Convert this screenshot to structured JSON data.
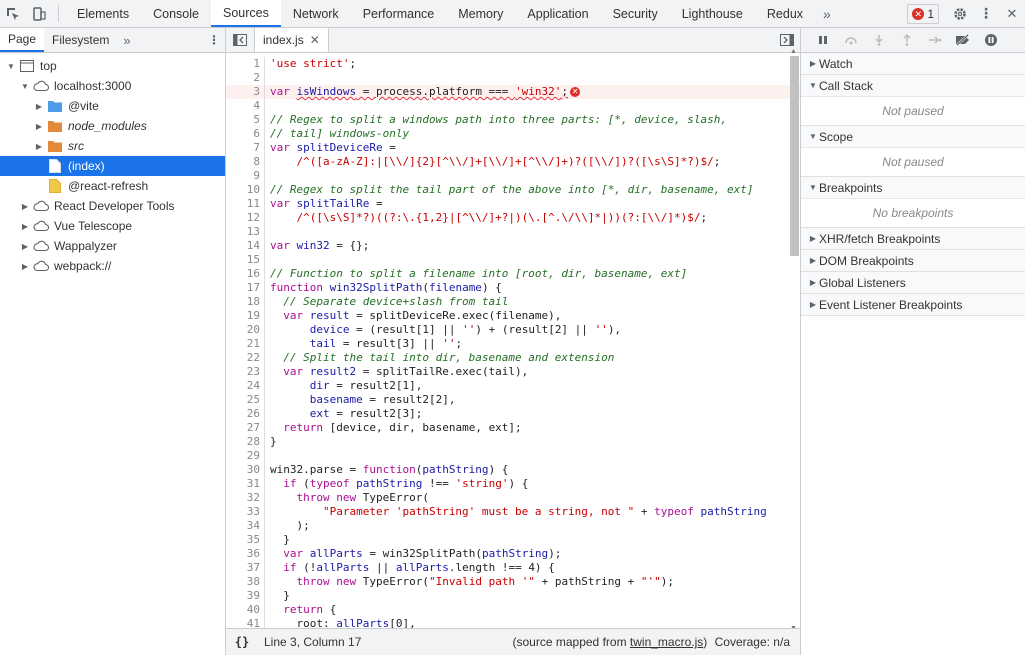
{
  "topbar": {
    "tabs": [
      {
        "label": "Elements"
      },
      {
        "label": "Console"
      },
      {
        "label": "Sources"
      },
      {
        "label": "Network"
      },
      {
        "label": "Performance"
      },
      {
        "label": "Memory"
      },
      {
        "label": "Application"
      },
      {
        "label": "Security"
      },
      {
        "label": "Lighthouse"
      },
      {
        "label": "Redux"
      }
    ],
    "active_tab": "Sources",
    "more_label": "»",
    "error_count": "1"
  },
  "navigator": {
    "tabs": [
      {
        "label": "Page"
      },
      {
        "label": "Filesystem"
      }
    ],
    "more_label": "»",
    "tree": [
      {
        "label": "top",
        "depth": 0,
        "tri": "▼",
        "icon": "frame-icon"
      },
      {
        "label": "localhost:3000",
        "depth": 1,
        "tri": "▼",
        "icon": "cloud-icon"
      },
      {
        "label": "@vite",
        "depth": 2,
        "tri": "▶",
        "icon": "folder-blue-icon"
      },
      {
        "label": "node_modules",
        "depth": 2,
        "tri": "▶",
        "icon": "folder-orange-icon",
        "italic": true
      },
      {
        "label": "src",
        "depth": 2,
        "tri": "▶",
        "icon": "folder-orange-icon",
        "italic": true
      },
      {
        "label": "(index)",
        "depth": 2,
        "tri": "",
        "icon": "file-white-icon",
        "selected": true
      },
      {
        "label": "@react-refresh",
        "depth": 2,
        "tri": "",
        "icon": "file-yellow-icon"
      },
      {
        "label": "React Developer Tools",
        "depth": 1,
        "tri": "▶",
        "icon": "cloud-icon"
      },
      {
        "label": "Vue Telescope",
        "depth": 1,
        "tri": "▶",
        "icon": "cloud-icon"
      },
      {
        "label": "Wappalyzer",
        "depth": 1,
        "tri": "▶",
        "icon": "cloud-icon"
      },
      {
        "label": "webpack://",
        "depth": 1,
        "tri": "▶",
        "icon": "cloud-icon"
      }
    ]
  },
  "editor": {
    "tab_label": "index.js",
    "tab_close": "✕",
    "lines": [
      {
        "n": "1",
        "html": "<span class='st'>'use strict'</span>;"
      },
      {
        "n": "2",
        "html": ""
      },
      {
        "n": "3",
        "err": true,
        "html": "<span class='kw'>var</span> <span class='var wavy'>isWindows</span><span class='wavy'> = process.platform === </span><span class='st wavy'>'win32'</span><span class='wavy'>;</span><span class='err-circle'>✕</span>"
      },
      {
        "n": "4",
        "html": ""
      },
      {
        "n": "5",
        "html": "<span class='cm'>// Regex to split a windows path into three parts: [*, device, slash,</span>"
      },
      {
        "n": "6",
        "html": "<span class='cm'>// tail] windows-only</span>"
      },
      {
        "n": "7",
        "html": "<span class='kw'>var</span> <span class='var'>splitDeviceRe</span> ="
      },
      {
        "n": "8",
        "html": "    <span class='st'>/^([a-zA-Z]:|[\\\\/]{2}[^\\\\/]+[\\\\/]+[^\\\\/]+)?([\\\\/])?([\\s\\S]*?)$/</span>;"
      },
      {
        "n": "9",
        "html": ""
      },
      {
        "n": "10",
        "html": "<span class='cm'>// Regex to split the tail part of the above into [*, dir, basename, ext]</span>"
      },
      {
        "n": "11",
        "html": "<span class='kw'>var</span> <span class='var'>splitTailRe</span> ="
      },
      {
        "n": "12",
        "html": "    <span class='st'>/^([\\s\\S]*?)((?:\\.{1,2}|[^\\\\/]+?|)(\\.[^.\\/\\\\]*|))(?:[\\\\/]*)$/</span>;"
      },
      {
        "n": "13",
        "html": ""
      },
      {
        "n": "14",
        "html": "<span class='kw'>var</span> <span class='var'>win32</span> = {};"
      },
      {
        "n": "15",
        "html": ""
      },
      {
        "n": "16",
        "html": "<span class='cm'>// Function to split a filename into [root, dir, basename, ext]</span>"
      },
      {
        "n": "17",
        "html": "<span class='kw'>function</span> <span class='fn'>win32SplitPath</span>(<span class='var'>filename</span>) {"
      },
      {
        "n": "18",
        "html": "  <span class='cm'>// Separate device+slash from tail</span>"
      },
      {
        "n": "19",
        "html": "  <span class='kw'>var</span> <span class='var'>result</span> = splitDeviceRe.exec(filename),"
      },
      {
        "n": "20",
        "html": "      <span class='var'>device</span> = (result[1] || <span class='st'>''</span>) + (result[2] || <span class='st'>''</span>),"
      },
      {
        "n": "21",
        "html": "      <span class='var'>tail</span> = result[3] || <span class='st'>''</span>;"
      },
      {
        "n": "22",
        "html": "  <span class='cm'>// Split the tail into dir, basename and extension</span>"
      },
      {
        "n": "23",
        "html": "  <span class='kw'>var</span> <span class='var'>result2</span> = splitTailRe.exec(tail),"
      },
      {
        "n": "24",
        "html": "      <span class='var'>dir</span> = result2[1],"
      },
      {
        "n": "25",
        "html": "      <span class='var'>basename</span> = result2[2],"
      },
      {
        "n": "26",
        "html": "      <span class='var'>ext</span> = result2[3];"
      },
      {
        "n": "27",
        "html": "  <span class='kw'>return</span> [device, dir, basename, ext];"
      },
      {
        "n": "28",
        "html": "}"
      },
      {
        "n": "29",
        "html": ""
      },
      {
        "n": "30",
        "html": "win32.parse = <span class='kw'>function</span>(<span class='var'>pathString</span>) {"
      },
      {
        "n": "31",
        "html": "  <span class='kw'>if</span> (<span class='kw'>typeof</span> <span class='var'>pathString</span> !== <span class='st'>'string'</span>) {"
      },
      {
        "n": "32",
        "html": "    <span class='kw'>throw</span> <span class='kw'>new</span> TypeError("
      },
      {
        "n": "33",
        "html": "        <span class='st'>\"Parameter 'pathString' must be a string, not \"</span> + <span class='kw'>typeof</span> <span class='var'>pathString</span>"
      },
      {
        "n": "34",
        "html": "    );"
      },
      {
        "n": "35",
        "html": "  }"
      },
      {
        "n": "36",
        "html": "  <span class='kw'>var</span> <span class='var'>allParts</span> = win32SplitPath(<span class='var'>pathString</span>);"
      },
      {
        "n": "37",
        "html": "  <span class='kw'>if</span> (!<span class='var'>allParts</span> || <span class='var'>allParts</span>.length !== 4) {"
      },
      {
        "n": "38",
        "html": "    <span class='kw'>throw</span> <span class='kw'>new</span> TypeError(<span class='st'>\"Invalid path '\"</span> + pathString + <span class='st'>\"'\"</span>);"
      },
      {
        "n": "39",
        "html": "  }"
      },
      {
        "n": "40",
        "html": "  <span class='kw'>return</span> {"
      },
      {
        "n": "41",
        "html": "    root: <span class='var'>allParts</span>[0],"
      }
    ],
    "status": {
      "braces": "{}",
      "position": "Line 3, Column 17",
      "source_prefix": "(source mapped from ",
      "source_link": "twin_macro.js",
      "source_suffix": ")",
      "coverage": "Coverage: n/a"
    }
  },
  "debugger": {
    "sections": [
      {
        "label": "Watch",
        "open": false
      },
      {
        "label": "Call Stack",
        "open": true,
        "body": "Not paused"
      },
      {
        "label": "Scope",
        "open": true,
        "body": "Not paused"
      },
      {
        "label": "Breakpoints",
        "open": true,
        "body": "No breakpoints"
      },
      {
        "label": "XHR/fetch Breakpoints",
        "open": false
      },
      {
        "label": "DOM Breakpoints",
        "open": false
      },
      {
        "label": "Global Listeners",
        "open": false
      },
      {
        "label": "Event Listener Breakpoints",
        "open": false
      }
    ]
  },
  "colors": {
    "accent": "#1a73e8",
    "error": "#d93025"
  }
}
